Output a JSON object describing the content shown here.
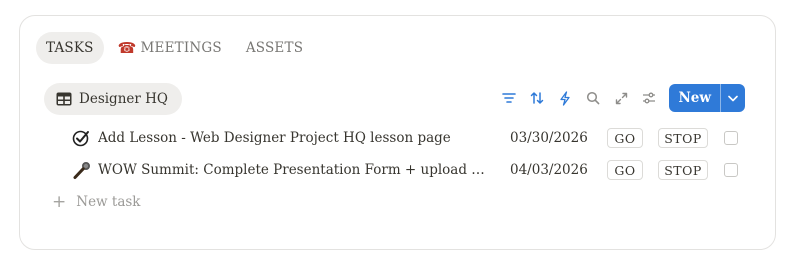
{
  "tabs": [
    {
      "label": "TASKS",
      "active": true
    },
    {
      "label": "MEETINGS",
      "icon": "telephone-icon",
      "active": false
    },
    {
      "label": "ASSETS",
      "active": false
    }
  ],
  "view": {
    "label": "Designer HQ",
    "icon": "table-icon"
  },
  "toolbar": {
    "icons": [
      "filter-icon",
      "sort-icon",
      "lightning-icon",
      "search-icon",
      "expand-icon",
      "settings-icon"
    ],
    "new_label": "New"
  },
  "rows": [
    {
      "icon": "checkmark-icon",
      "title": "Add Lesson - Web Designer Project HQ lesson page",
      "date": "03/30/2026",
      "go": "GO",
      "stop": "STOP",
      "checked": false
    },
    {
      "icon": "microphone-icon",
      "title": "WOW Summit: Complete Presentation Form + upload materi…",
      "date": "04/03/2026",
      "go": "GO",
      "stop": "STOP",
      "checked": false
    }
  ],
  "new_task_label": "New task",
  "colors": {
    "accent": "#2f7ad8",
    "tab_active_bg": "#efeeec",
    "text": "#37352f",
    "muted": "#787774"
  }
}
